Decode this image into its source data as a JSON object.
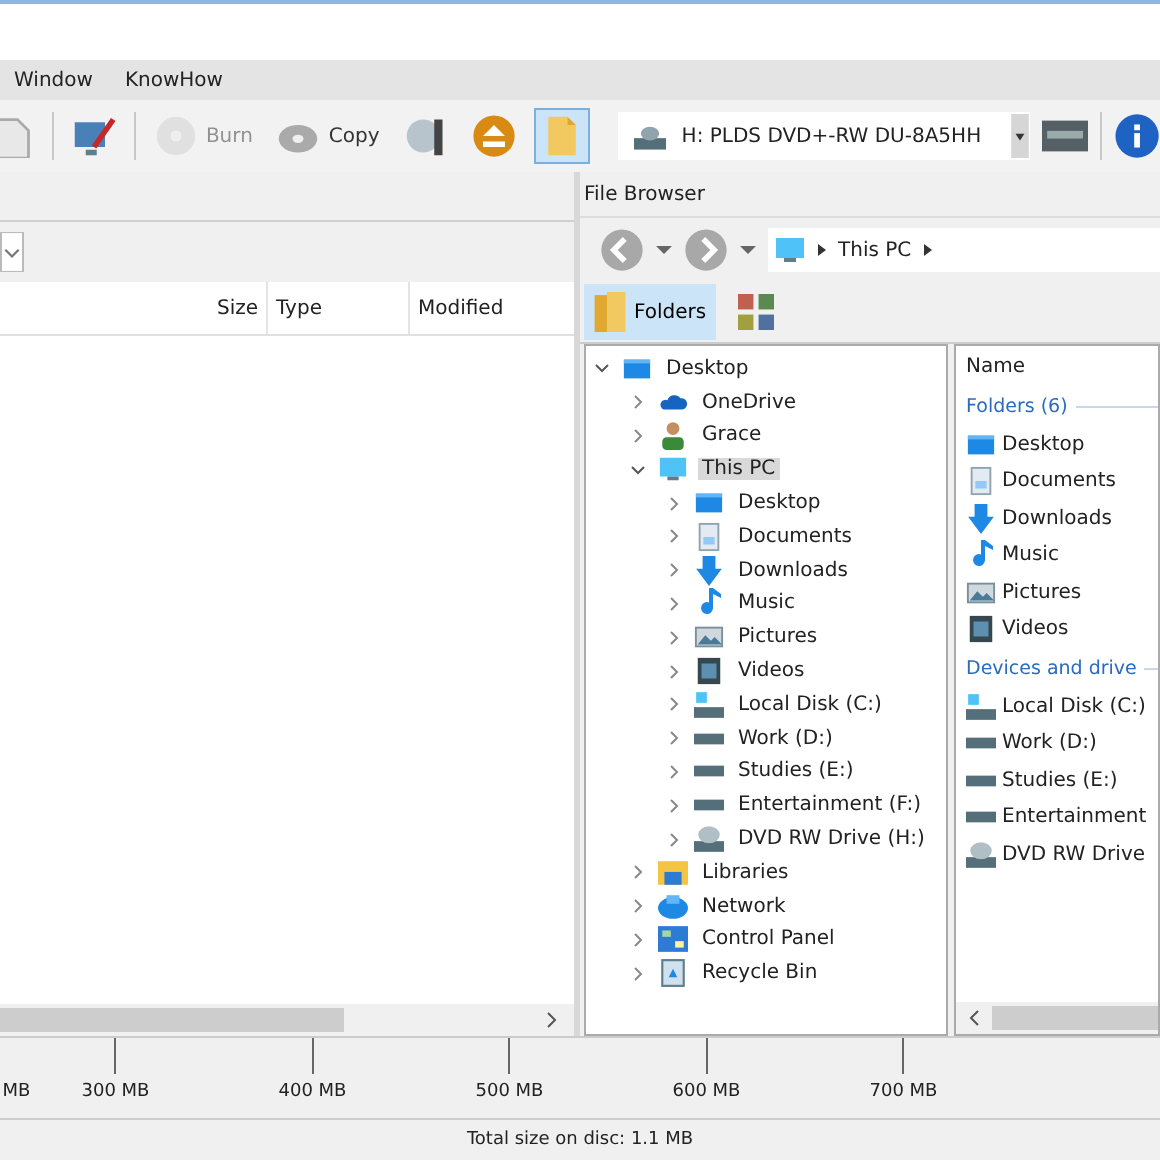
{
  "menu": [
    "Window",
    "KnowHow"
  ],
  "toolbar": [
    {
      "kind": "page",
      "disabled": false,
      "selected": false
    },
    {
      "kind": "edit",
      "disabled": false,
      "selected": false
    },
    {
      "kind": "burn",
      "label": "Burn",
      "disabled": true,
      "selected": false
    },
    {
      "kind": "disc",
      "label": "Copy",
      "disabled": false,
      "selected": false
    },
    {
      "kind": "copydisc",
      "disabled": false,
      "selected": false
    },
    {
      "kind": "eject",
      "disabled": false,
      "selected": false
    },
    {
      "kind": "folder",
      "disabled": false,
      "selected": true
    }
  ],
  "drive_select": {
    "value": "H: PLDS DVD+-RW DU-8A5HH"
  },
  "compilation": {
    "columns": [
      "Size",
      "Type",
      "Modified"
    ]
  },
  "file_browser": {
    "title": "File Browser",
    "path": [
      "This PC"
    ],
    "views": [
      {
        "label": "Folders",
        "selected": true
      },
      {
        "selected": false
      }
    ],
    "tree": [
      {
        "label": "Desktop",
        "kind": "desktop",
        "expanded": true,
        "selected": false,
        "children": [
          {
            "label": "OneDrive",
            "kind": "cloud",
            "expanded": false,
            "selected": false
          },
          {
            "label": "Grace",
            "kind": "user",
            "expanded": false,
            "selected": false
          },
          {
            "label": "This PC",
            "kind": "pc",
            "expanded": true,
            "selected": true,
            "children": [
              {
                "label": "Desktop",
                "kind": "desktop",
                "expanded": false,
                "selected": false
              },
              {
                "label": "Documents",
                "kind": "documents",
                "expanded": false,
                "selected": false
              },
              {
                "label": "Downloads",
                "kind": "downloads",
                "expanded": false,
                "selected": false
              },
              {
                "label": "Music",
                "kind": "music",
                "expanded": false,
                "selected": false
              },
              {
                "label": "Pictures",
                "kind": "pictures",
                "expanded": false,
                "selected": false
              },
              {
                "label": "Videos",
                "kind": "videos",
                "expanded": false,
                "selected": false
              },
              {
                "label": "Local Disk (C:)",
                "kind": "sysdisk",
                "expanded": false,
                "selected": false
              },
              {
                "label": "Work (D:)",
                "kind": "disk",
                "expanded": false,
                "selected": false
              },
              {
                "label": "Studies (E:)",
                "kind": "disk",
                "expanded": false,
                "selected": false
              },
              {
                "label": "Entertainment (F:)",
                "kind": "disk",
                "expanded": false,
                "selected": false
              },
              {
                "label": "DVD RW Drive (H:)",
                "kind": "dvd",
                "expanded": false,
                "selected": false
              }
            ]
          },
          {
            "label": "Libraries",
            "kind": "libraries",
            "expanded": false,
            "selected": false
          },
          {
            "label": "Network",
            "kind": "network",
            "expanded": false,
            "selected": false
          },
          {
            "label": "Control Panel",
            "kind": "control",
            "expanded": false,
            "selected": false
          },
          {
            "label": "Recycle Bin",
            "kind": "recycle",
            "expanded": false,
            "selected": false
          }
        ]
      }
    ],
    "list": {
      "column": "Name",
      "groups": [
        {
          "title": "Folders (6)",
          "items": [
            {
              "label": "Desktop",
              "kind": "desktop"
            },
            {
              "label": "Documents",
              "kind": "documents"
            },
            {
              "label": "Downloads",
              "kind": "downloads"
            },
            {
              "label": "Music",
              "kind": "music"
            },
            {
              "label": "Pictures",
              "kind": "pictures"
            },
            {
              "label": "Videos",
              "kind": "videos"
            }
          ]
        },
        {
          "title": "Devices and drive",
          "items": [
            {
              "label": "Local Disk (C:)",
              "kind": "sysdisk"
            },
            {
              "label": "Work (D:)",
              "kind": "disk"
            },
            {
              "label": "Studies (E:)",
              "kind": "disk"
            },
            {
              "label": "Entertainment",
              "kind": "disk"
            },
            {
              "label": "DVD RW Drive",
              "kind": "dvd"
            }
          ]
        }
      ]
    }
  },
  "ruler": {
    "ticks": [
      "MB",
      "300 MB",
      "400 MB",
      "500 MB",
      "600 MB",
      "700 MB"
    ]
  },
  "status_bar": {
    "text": "Total size on disc: 1.1 MB"
  }
}
